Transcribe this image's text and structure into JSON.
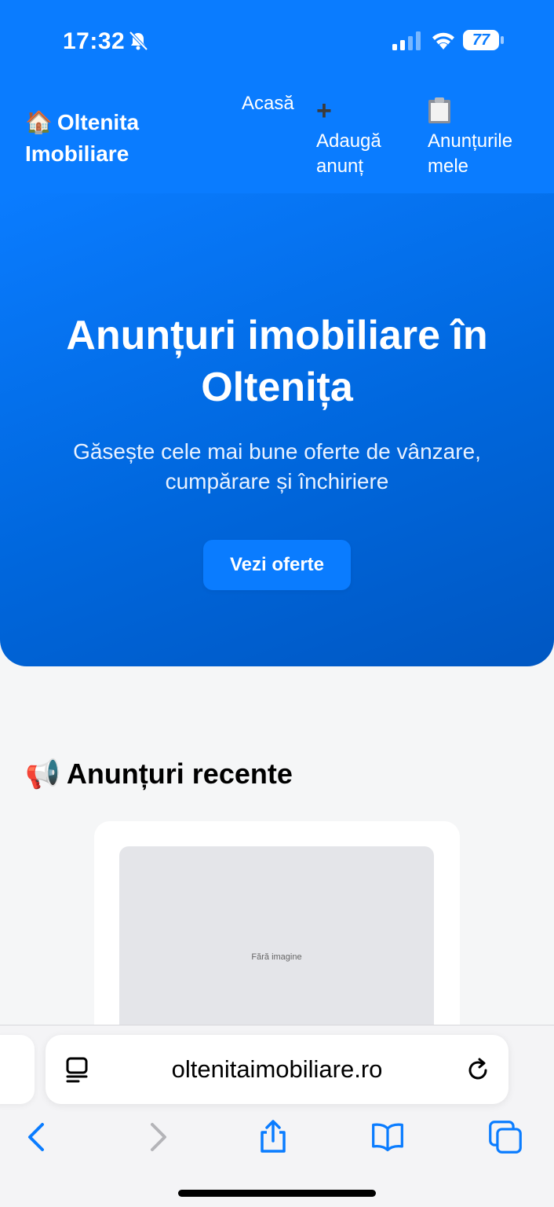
{
  "status_bar": {
    "time": "17:32",
    "battery": "77",
    "icons": [
      "bell-slash-icon",
      "cellular-signal-icon",
      "wifi-icon",
      "battery-icon"
    ]
  },
  "header": {
    "logo_emoji": "🏠",
    "logo_text": "Oltenita Imobiliare",
    "nav": {
      "home": "Acasă",
      "add_icon": "➕",
      "add": "Adaugă anunț",
      "mine_icon": "clipboard-icon",
      "mine": "Anunțurile mele"
    }
  },
  "hero": {
    "title": "Anunțuri imobiliare în Oltenița",
    "subtitle": "Găsește cele mai bune oferte de vânzare, cumpărare și închiriere",
    "cta": "Vezi oferte"
  },
  "recent": {
    "emoji": "📢",
    "title": "Anunțuri recente",
    "cards": [
      {
        "image_placeholder": "Fără imagine"
      }
    ]
  },
  "browser": {
    "url": "oltenitaimobiliare.ro",
    "toolbar": [
      "back-icon",
      "forward-icon",
      "share-icon",
      "bookmarks-icon",
      "tabs-icon"
    ]
  },
  "colors": {
    "brand_blue": "#0a7cff",
    "hero_dark": "#0057c2",
    "safari_blue": "#0a7cff"
  }
}
